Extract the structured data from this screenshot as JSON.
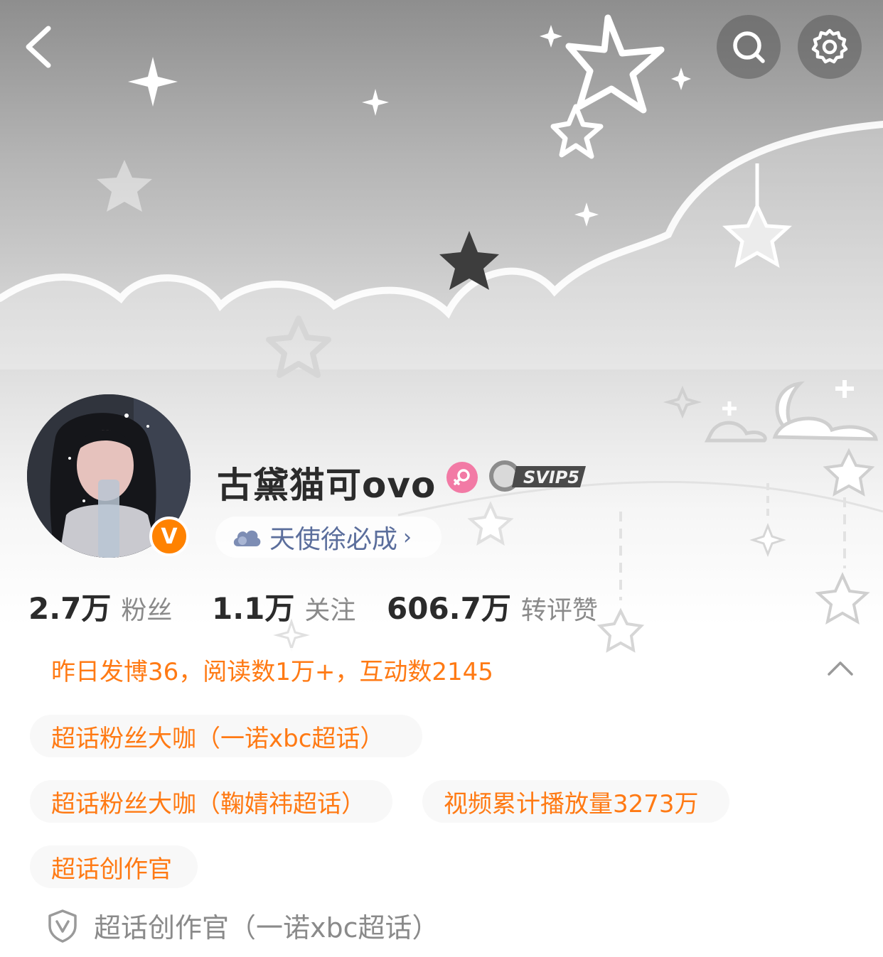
{
  "header": {
    "back_icon": "chevron-left-icon",
    "search_icon": "search-icon",
    "settings_icon": "gear-icon"
  },
  "profile": {
    "username": "古黛猫可ovo",
    "gender_icon": "female-icon",
    "vip_badge": "SVIP5",
    "verified_badge": "V",
    "linked_name": "天使徐必成",
    "colors": {
      "accent": "#ff7a14",
      "verified": "#ff8200",
      "female": "#f27aa5",
      "link": "#5b6e9c"
    }
  },
  "stats": [
    {
      "value": "2.7万",
      "label": "粉丝"
    },
    {
      "value": "1.1万",
      "label": "关注"
    },
    {
      "value": "606.7万",
      "label": "转评赞"
    }
  ],
  "summary": "昨日发博36，阅读数1万+，互动数2145",
  "tags": [
    "超话粉丝大咖（一诺xbc超话）",
    "超话粉丝大咖（鞠婧祎超话）",
    "视频累计播放量3273万",
    "超话创作官"
  ],
  "honor": {
    "icon": "shield-v-icon",
    "text": "超话创作官（一诺xbc超话）"
  }
}
